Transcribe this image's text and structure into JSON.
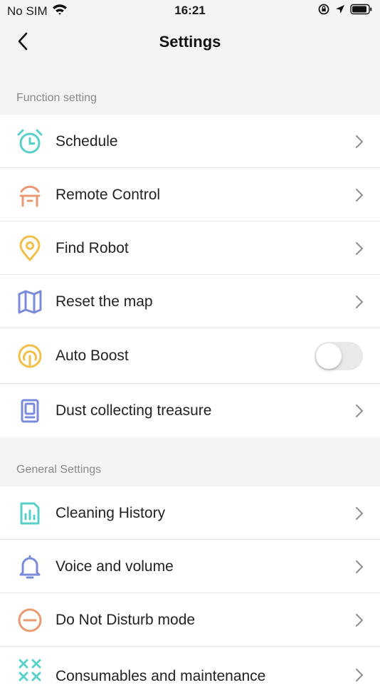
{
  "status_bar": {
    "carrier": "No SIM",
    "time": "16:21"
  },
  "header": {
    "title": "Settings"
  },
  "sections": {
    "function": {
      "title": "Function setting",
      "items": [
        {
          "label": "Schedule",
          "icon": "alarm-clock-icon",
          "color": "#5bcfc9"
        },
        {
          "label": "Remote Control",
          "icon": "remote-control-icon",
          "color": "#e79a73"
        },
        {
          "label": "Find Robot",
          "icon": "location-pin-icon",
          "color": "#f0c04a"
        },
        {
          "label": "Reset the map",
          "icon": "map-icon",
          "color": "#7c8bd9"
        },
        {
          "label": "Auto Boost",
          "icon": "boost-gauge-icon",
          "color": "#f0c04a",
          "toggle_on": false
        },
        {
          "label": "Dust collecting treasure",
          "icon": "dust-station-icon",
          "color": "#7c8bd9"
        }
      ]
    },
    "general": {
      "title": "General Settings",
      "items": [
        {
          "label": "Cleaning History",
          "icon": "report-icon",
          "color": "#5bcfc9"
        },
        {
          "label": "Voice and volume",
          "icon": "bell-icon",
          "color": "#7c8bd9"
        },
        {
          "label": "Do Not Disturb mode",
          "icon": "do-not-disturb-icon",
          "color": "#e79a73"
        },
        {
          "label": "Consumables and maintenance",
          "icon": "consumables-icon",
          "color": "#5bcfc9"
        }
      ]
    }
  }
}
